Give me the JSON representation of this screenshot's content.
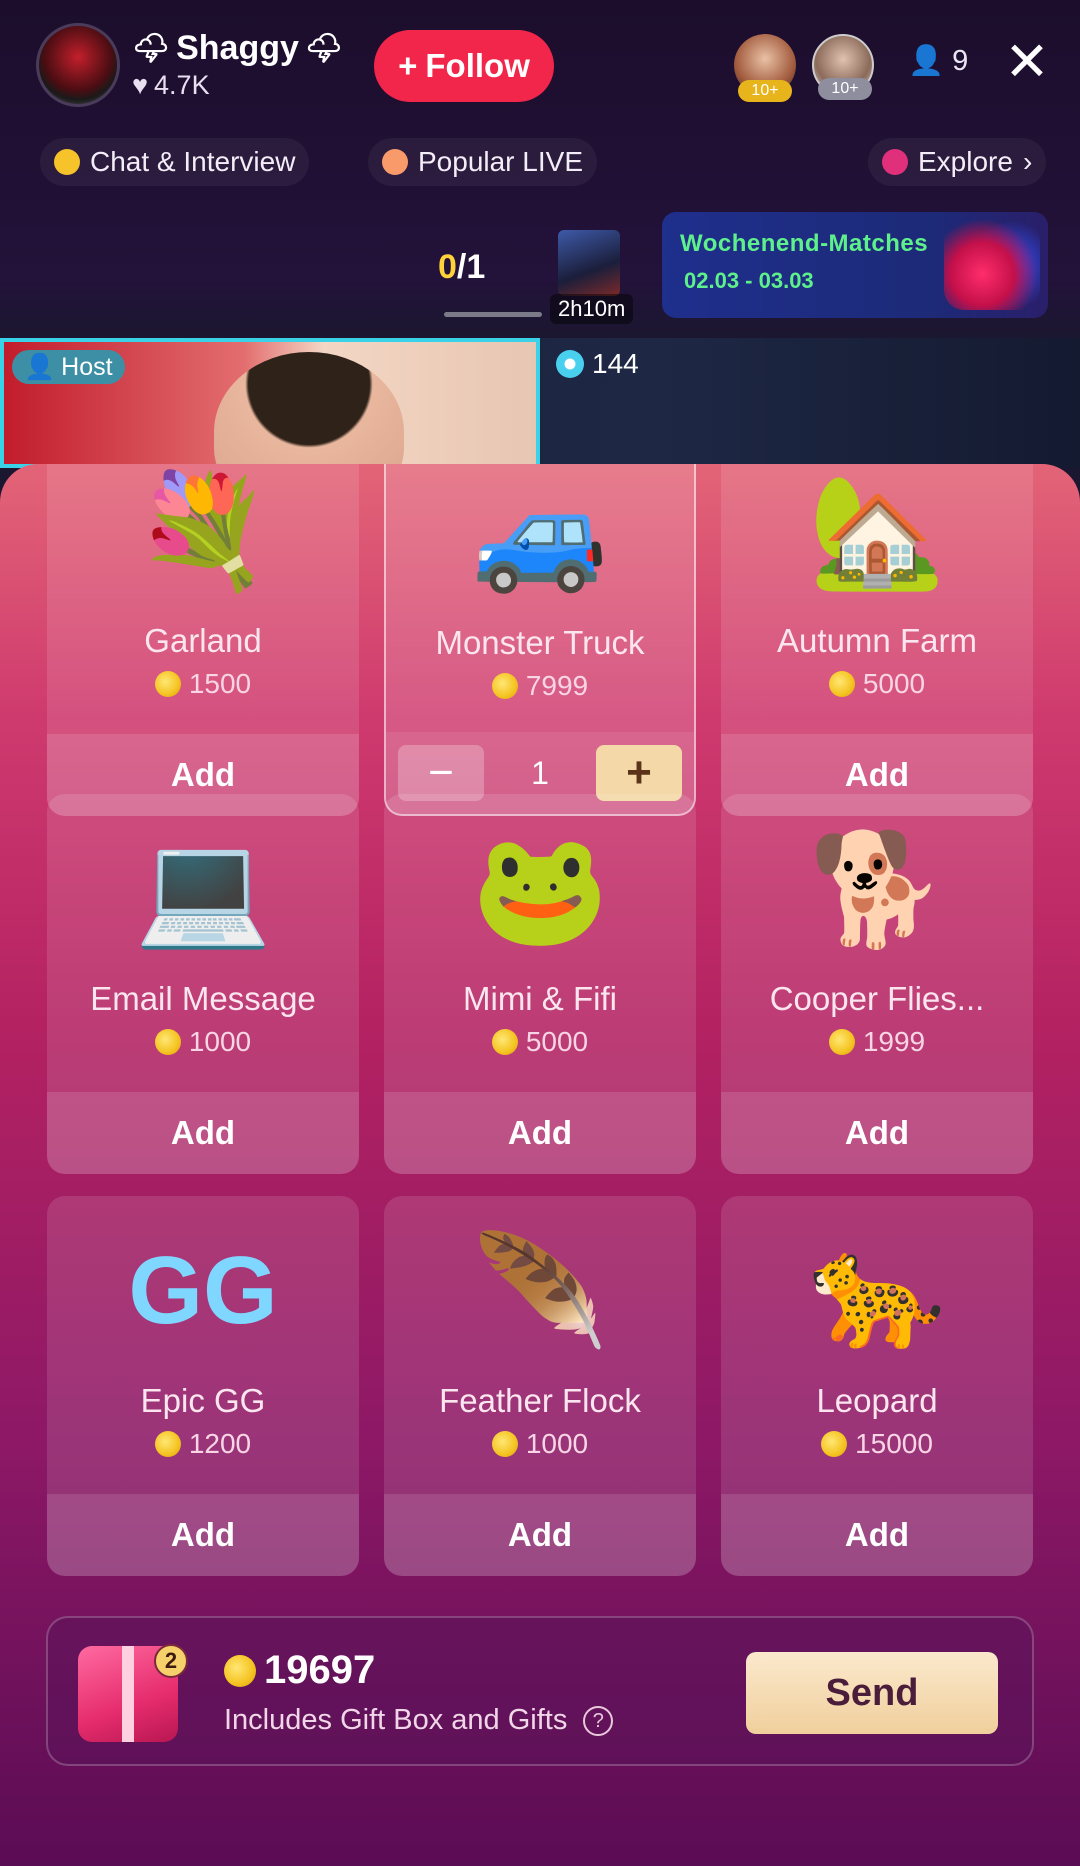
{
  "header": {
    "host_name": "Shaggy",
    "host_likes": "4.7K",
    "follow_label": "Follow",
    "viewer_badge_1": "10+",
    "viewer_badge_2": "10+",
    "viewer_count": "9"
  },
  "tags": {
    "chat": "Chat & Interview",
    "popular": "Popular LIVE",
    "explore": "Explore"
  },
  "match": {
    "score_current": "0",
    "score_total": "/1",
    "timer": "2h10m",
    "event_title": "Wochenend-Matches",
    "event_dates": "02.03 - 03.03"
  },
  "stream": {
    "host_badge": "Host",
    "gem_count": "144"
  },
  "gifts": [
    {
      "name": "Garland",
      "price": "1500",
      "action": "Add",
      "icon": "garland-icon"
    },
    {
      "name": "Monster Truck",
      "price": "7999",
      "quantity": "1",
      "selected": true,
      "icon": "monster-truck-icon"
    },
    {
      "name": "Autumn Farm",
      "price": "5000",
      "action": "Add",
      "icon": "autumn-farm-icon"
    },
    {
      "name": "Email Message",
      "price": "1000",
      "action": "Add",
      "icon": "email-message-icon"
    },
    {
      "name": "Mimi & Fifi",
      "price": "5000",
      "action": "Add",
      "icon": "mimi-fifi-icon"
    },
    {
      "name": "Cooper Flies...",
      "price": "1999",
      "action": "Add",
      "icon": "cooper-flies-icon"
    },
    {
      "name": "Epic GG",
      "price": "1200",
      "action": "Add",
      "icon": "epic-gg-icon"
    },
    {
      "name": "Feather Flock",
      "price": "1000",
      "action": "Add",
      "icon": "feather-flock-icon"
    },
    {
      "name": "Leopard",
      "price": "15000",
      "action": "Add",
      "icon": "leopard-icon"
    }
  ],
  "send_bar": {
    "box_count": "2",
    "total": "19697",
    "includes": "Includes Gift Box and Gifts",
    "send_label": "Send"
  },
  "colors": {
    "follow": "#f2264a",
    "accent_cyan": "#3ad2e6",
    "event_text": "#5ef08a",
    "send_button": "#f0cf9c"
  }
}
